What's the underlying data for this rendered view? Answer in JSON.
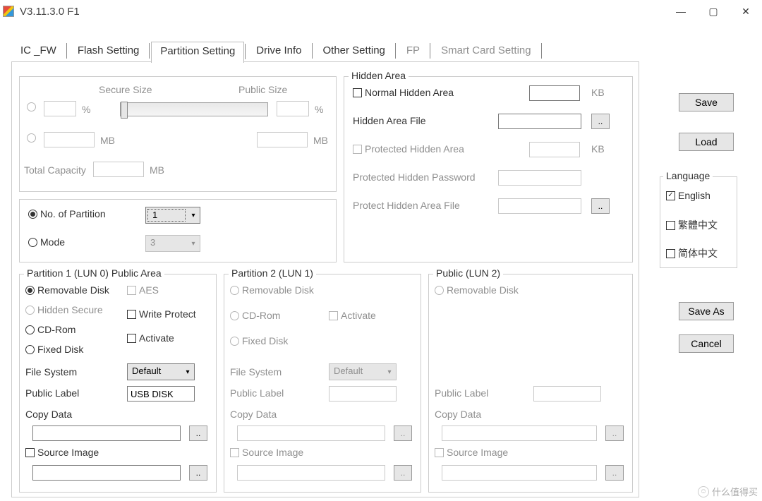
{
  "title": "V3.11.3.0 F1",
  "tabs": [
    "IC _FW",
    "Flash Setting",
    "Partition Setting",
    "Drive Info",
    "Other Setting",
    "FP",
    "Smart Card Setting"
  ],
  "active_tab": 2,
  "size_panel": {
    "secure_label": "Secure Size",
    "public_label": "Public Size",
    "pct": "%",
    "mb": "MB",
    "total_label": "Total Capacity"
  },
  "part_count": {
    "num_label": "No. of Partition",
    "num_value": "1",
    "mode_label": "Mode",
    "mode_value": "3"
  },
  "hidden": {
    "legend": "Hidden Area",
    "normal": "Normal Hidden Area",
    "kb": "KB",
    "file": "Hidden Area File",
    "prot": "Protected Hidden Area",
    "pw": "Protected Hidden Password",
    "pfile": "Protect Hidden Area File",
    "browse": ".."
  },
  "p1": {
    "legend": "Partition 1 (LUN 0) Public Area",
    "removable": "Removable Disk",
    "hidden_secure": "Hidden Secure",
    "cdrom": "CD-Rom",
    "fixed": "Fixed Disk",
    "aes": "AES",
    "wprotect": "Write Protect",
    "activate": "Activate",
    "fs": "File System",
    "fs_value": "Default",
    "label": "Public Label",
    "label_value": "USB DISK",
    "copy": "Copy Data",
    "source": "Source Image"
  },
  "p2": {
    "legend": "Partition 2 (LUN 1)",
    "removable": "Removable Disk",
    "cdrom": "CD-Rom",
    "fixed": "Fixed Disk",
    "activate": "Activate",
    "fs": "File System",
    "fs_value": "Default",
    "label": "Public Label",
    "copy": "Copy Data",
    "source": "Source Image"
  },
  "p3": {
    "legend": "Public (LUN 2)",
    "removable": "Removable Disk",
    "label": "Public Label",
    "copy": "Copy Data",
    "source": "Source Image"
  },
  "buttons": {
    "save": "Save",
    "load": "Load",
    "saveas": "Save As",
    "cancel": "Cancel"
  },
  "lang": {
    "legend": "Language",
    "en": "English",
    "tc": "繁體中文",
    "sc": "简体中文"
  },
  "watermark": "什么值得买"
}
